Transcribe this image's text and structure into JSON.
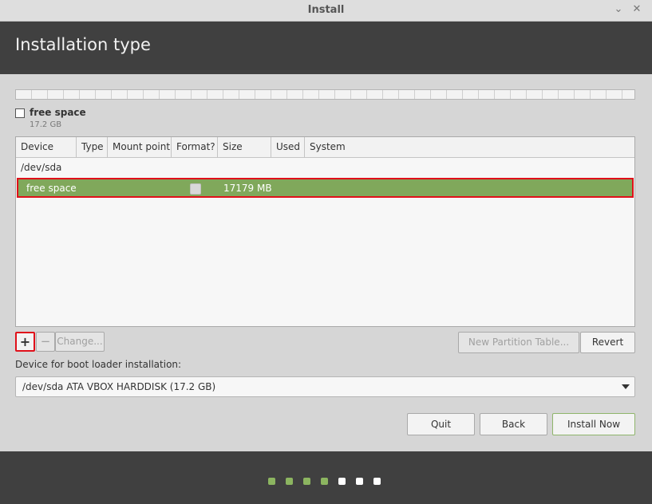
{
  "window": {
    "title": "Install",
    "minimize_glyph": "⌄",
    "close_glyph": "✕"
  },
  "header": {
    "title": "Installation type"
  },
  "disk_bar": {
    "legend_label": "free space",
    "legend_size": "17.2 GB"
  },
  "table": {
    "columns": [
      "Device",
      "Type",
      "Mount point",
      "Format?",
      "Size",
      "Used",
      "System"
    ],
    "device_row": "/dev/sda",
    "selected_row": {
      "device": "free space",
      "size": "17179 MB",
      "format_checked": false
    }
  },
  "partition_buttons": {
    "add": "+",
    "remove": "−",
    "change": "Change...",
    "new_table": "New Partition Table...",
    "revert": "Revert"
  },
  "bootloader": {
    "label": "Device for boot loader installation:",
    "selected": "/dev/sda ATA VBOX HARDDISK (17.2 GB)"
  },
  "nav_buttons": {
    "quit": "Quit",
    "back": "Back",
    "install": "Install Now"
  },
  "progress": {
    "steps_total": 7,
    "steps_done": 4,
    "done_color": "#8cb560",
    "todo_color": "#ffffff"
  },
  "colors": {
    "header_bg": "#404040",
    "selection_bg": "#80a85b",
    "highlight_border": "#e0101a"
  }
}
